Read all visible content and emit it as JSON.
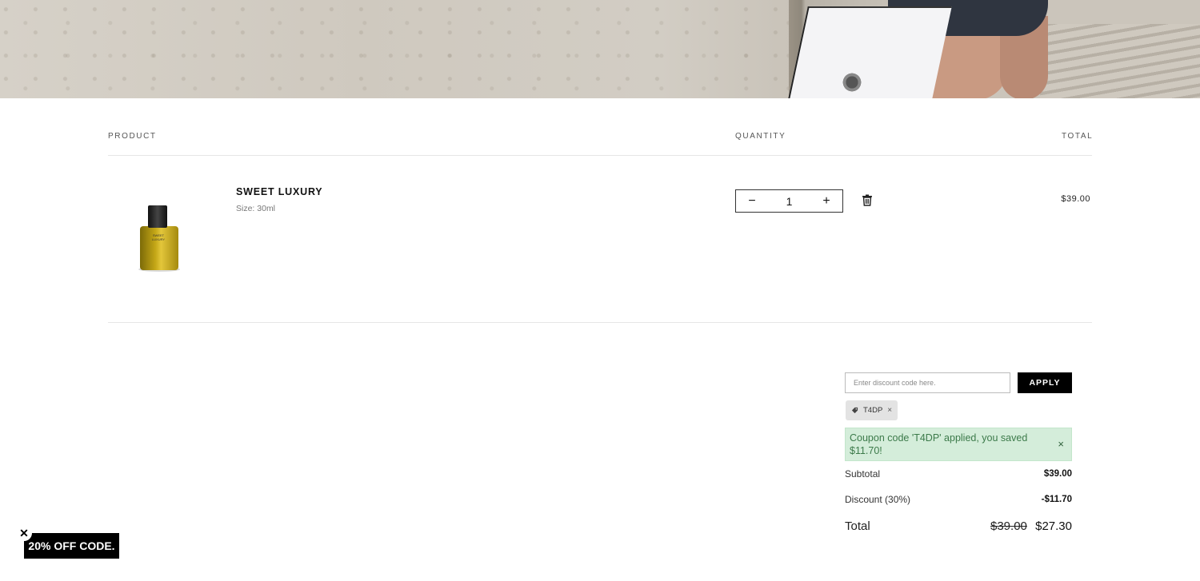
{
  "table": {
    "col_product": "PRODUCT",
    "col_quantity": "QUANTITY",
    "col_total": "TOTAL"
  },
  "item": {
    "image_text": "SWEET LUXURY",
    "name": "SWEET LUXURY",
    "size": "Size: 30ml",
    "quantity": "1",
    "price": "$39.00",
    "decrement_symbol": "−",
    "increment_symbol": "+"
  },
  "discount": {
    "placeholder": "Enter discount code here.",
    "apply_label": "APPLY",
    "applied_code": "T4DP",
    "remove_symbol": "×",
    "success_message": "Coupon code 'T4DP' applied, you saved $11.70!",
    "close_symbol": "×",
    "alert_color": "#d4edda"
  },
  "summary": {
    "subtotal_label": "Subtotal",
    "subtotal_value": "$39.00",
    "discount_label": "Discount (30%)",
    "discount_value": "-$11.70",
    "total_label": "Total",
    "total_old": "$39.00",
    "total_new": "$27.30"
  },
  "promo": {
    "label": "20% OFF CODE.",
    "close_symbol": "✕"
  }
}
